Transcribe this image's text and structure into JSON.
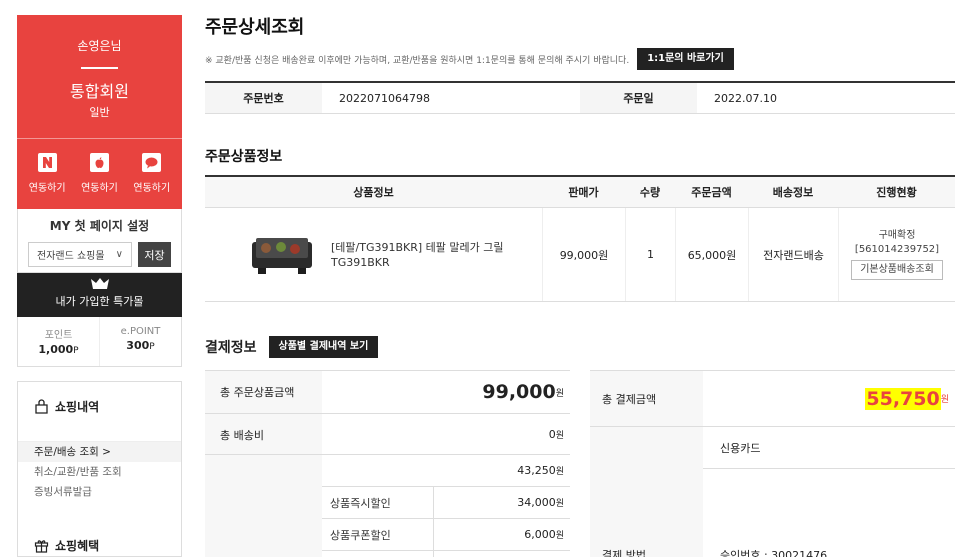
{
  "sidebar": {
    "user_name": "손영은님",
    "grade": "통합회원",
    "grade_sub": "일반",
    "sns": [
      {
        "icon": "naver-icon",
        "label": "연동하기"
      },
      {
        "icon": "apple-icon",
        "label": "연동하기"
      },
      {
        "icon": "kakao-icon",
        "label": "연동하기"
      }
    ],
    "mypage_title": "MY 첫 페이지 설정",
    "mypage_select": "전자랜드 쇼핑몰",
    "save_label": "저장",
    "benefit_label": "내가 가입한 특가몰",
    "point_label": "포인트",
    "point_value": "1,000",
    "point_unit": "P",
    "epoint_label": "e.POINT",
    "epoint_value": "300",
    "epoint_unit": "P",
    "shopping_history": "쇼핑내역",
    "menu": [
      "주문/배송 조회 >",
      "취소/교환/반품 조회",
      "증빙서류발급"
    ],
    "shopping_benefit": "쇼핑혜택"
  },
  "main": {
    "title": "주문상세조회",
    "notice": "※ 교환/반품 신청은 배송완료 이후에만 가능하며, 교환/반품을 원하시면 1:1문의를 통해 문의해 주시기 바랍니다.",
    "inquiry_button": "1:1문의 바로가기",
    "order_no_label": "주문번호",
    "order_no": "2022071064798",
    "order_date_label": "주문일",
    "order_date": "2022.07.10",
    "products_title": "주문상품정보",
    "product_headers": [
      "상품정보",
      "판매가",
      "수량",
      "주문금액",
      "배송정보",
      "진행현황"
    ],
    "product": {
      "name": "[테팔/TG391BKR] 테팔 말레가 그릴 TG391BKR",
      "price": "99,000원",
      "qty": "1",
      "order_amount": "65,000원",
      "delivery": "전자랜드배송",
      "status": "구매확정",
      "tracking": "[561014239752]",
      "tracking_button": "기본상품배송조회"
    },
    "payment_title": "결제정보",
    "payment_button": "상품별 결제내역 보기",
    "payment_left": {
      "total_label": "총 주문상품금액",
      "total_value": "99,000",
      "shipping_label": "총 배송비",
      "shipping_value": "0",
      "discount_total": "43,250",
      "sub": [
        {
          "label": "상품즉시할인",
          "value": "34,000"
        },
        {
          "label": "상품쿠폰할인",
          "value": "6,000"
        }
      ],
      "unit": "원"
    },
    "payment_right": {
      "total_label": "총 결제금액",
      "total_value": "55,750",
      "unit": "원",
      "method_label": "결제 방법",
      "method": "신용카드",
      "approval": "승인번호 : 30021476"
    }
  },
  "colors": {
    "accent": "#e8433f",
    "highlight": "#ffff00",
    "dark": "#222222"
  }
}
